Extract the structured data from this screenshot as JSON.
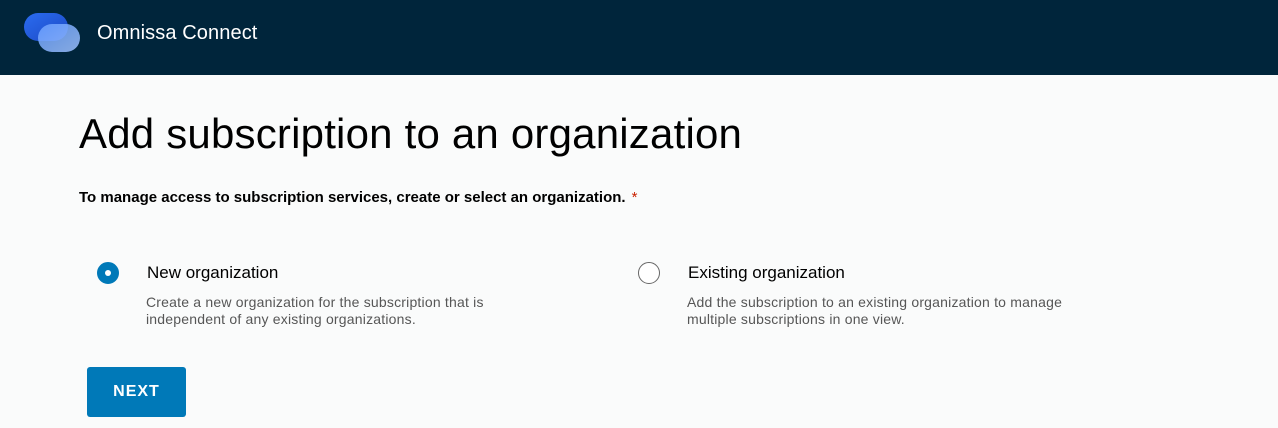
{
  "app": {
    "title": "Omnissa Connect",
    "logo_icon": "omnissa-logo-icon",
    "header_color": "#00253b"
  },
  "page": {
    "title": "Add subscription to an organization",
    "instruction": "To manage access to subscription services, create or select an organization.",
    "required_marker": "*"
  },
  "options": [
    {
      "label": "New organization",
      "description": "Create a new organization for the subscription that is independent of any existing organizations.",
      "selected": true
    },
    {
      "label": "Existing organization",
      "description": "Add the subscription to an existing organization to manage multiple subscriptions in one view.",
      "selected": false
    }
  ],
  "actions": {
    "next_label": "NEXT"
  },
  "colors": {
    "accent": "#0079b8",
    "required": "#c92100"
  }
}
